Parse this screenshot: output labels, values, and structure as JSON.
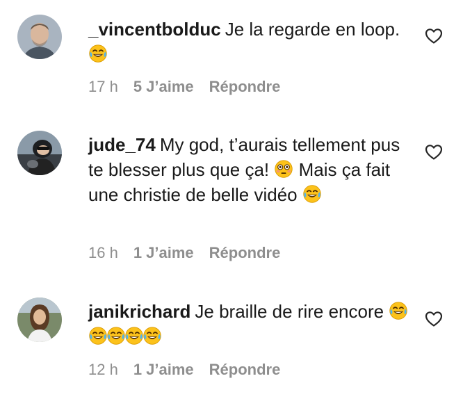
{
  "actions": {
    "reply_label": "Répondre"
  },
  "comments": [
    {
      "username": "_vincentbolduc",
      "text_before": "Je la regarde en loop.",
      "text_after": "",
      "time": "17 h",
      "likes": "5 J’aime"
    },
    {
      "username": "jude_74",
      "text_before": "My god, t’aurais tellement pus te blesser plus que ça!",
      "text_after": "Mais ça fait une christie de belle vidéo",
      "time": "16 h",
      "likes": "1 J’aime"
    },
    {
      "username": "janikrichard",
      "text_before": "Je braille de rire encore",
      "text_after": "",
      "time": "12 h",
      "likes": "1 J’aime"
    }
  ],
  "icons": {
    "like": "heart-outline-icon",
    "laughing": "face-with-tears-of-joy-emoji",
    "flushed": "flushed-face-emoji"
  },
  "colors": {
    "meta_text": "#8e8e8e",
    "body_text": "#1a1a1a",
    "emoji_yellow": "#fcc21b"
  }
}
